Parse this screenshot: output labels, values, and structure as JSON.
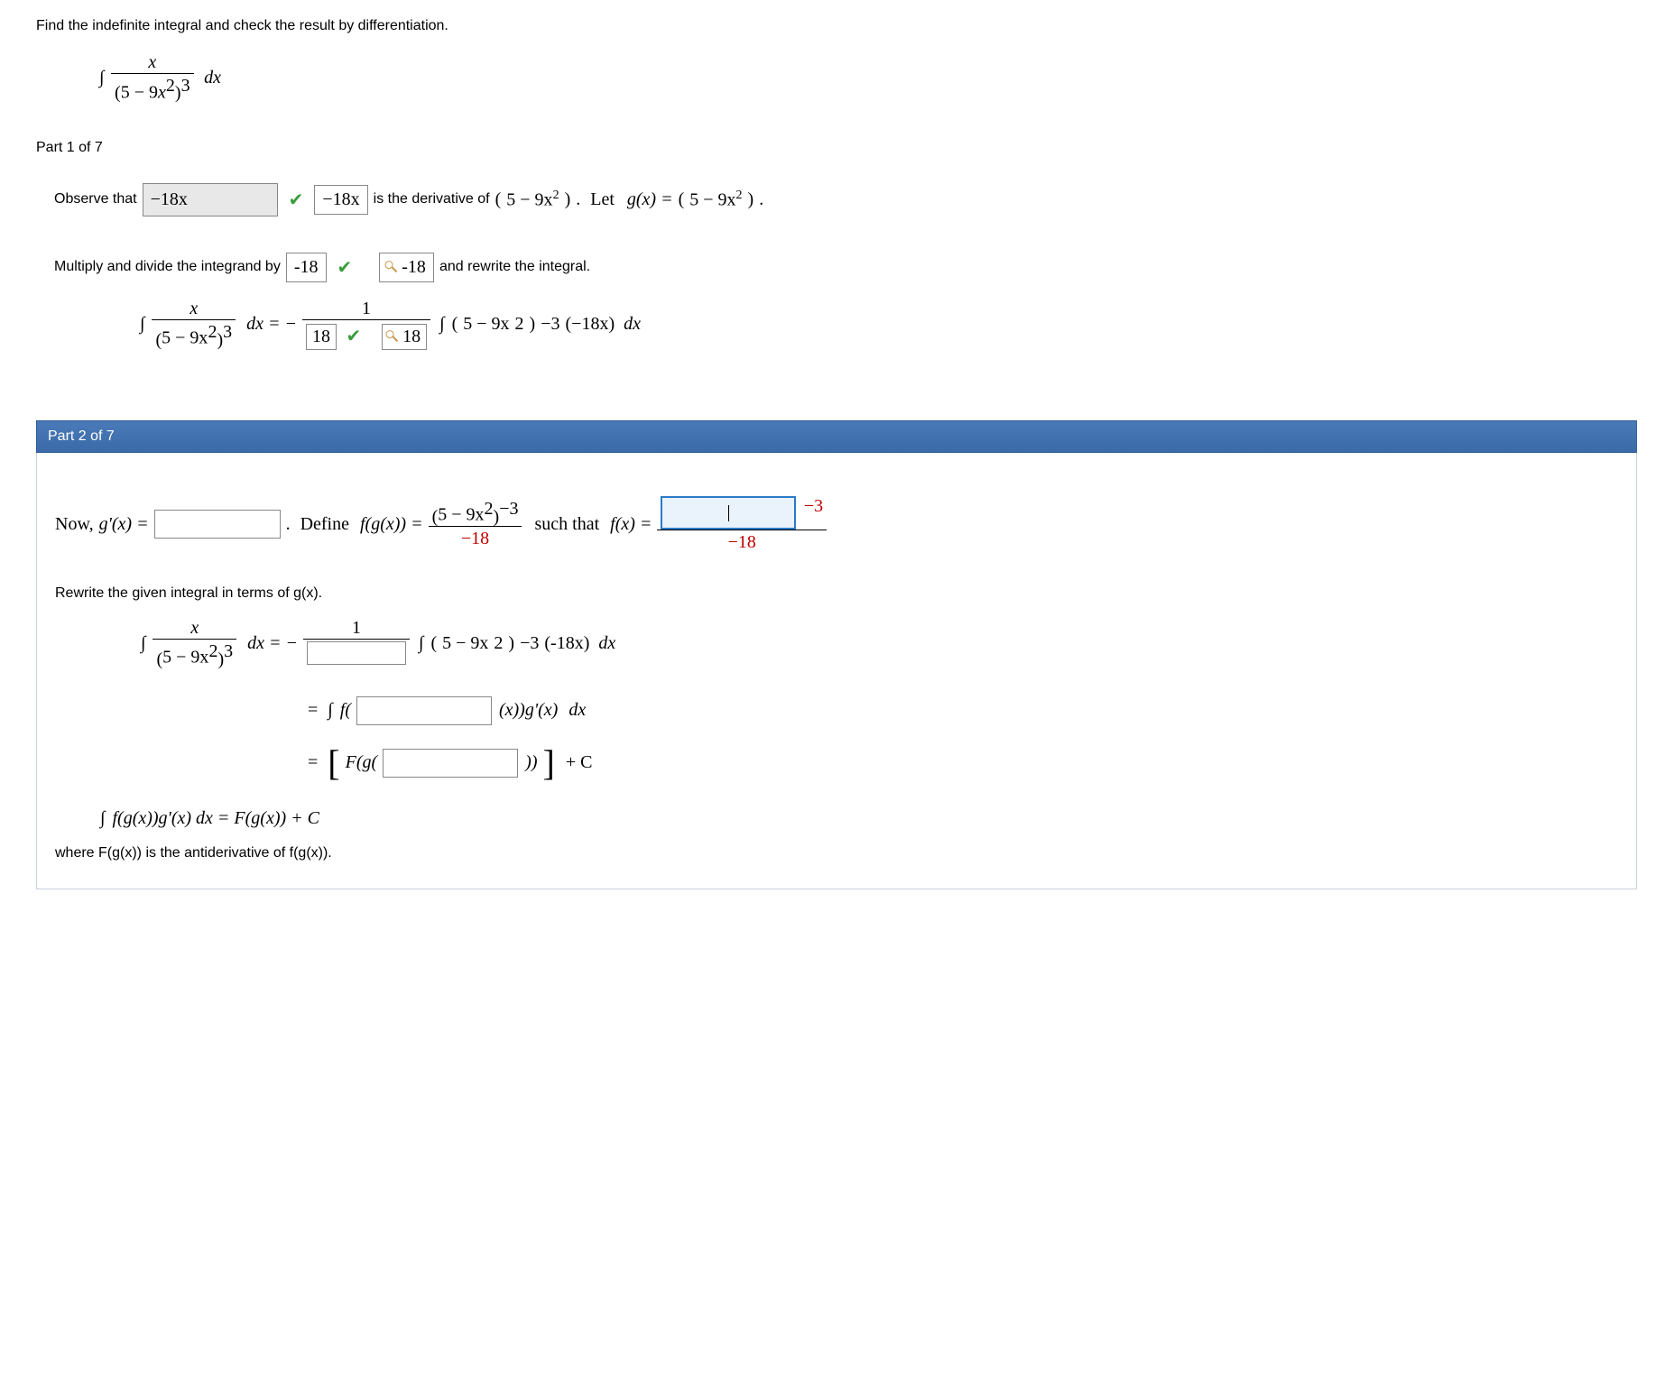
{
  "problem": "Find the indefinite integral and check the result by differentiation.",
  "integral": {
    "numerator_var": "x",
    "denom_base_a": "5",
    "denom_sign": " − ",
    "denom_coef": "9",
    "denom_var": "x",
    "denom_var_exp": "2",
    "denom_exp": "3",
    "dvar": "dx"
  },
  "part1": {
    "label": "Part 1 of 7",
    "observe_text_a": "Observe that",
    "observe_input": "−18x",
    "observe_answer": "−18x",
    "observe_text_b": "is the derivative of",
    "expr_5m9x2": "5 − 9x",
    "exp2": "2",
    "let_text": "Let",
    "g_def": "g(x) =",
    "multiply_text": "Multiply and divide the integrand by",
    "mult_box": "-18",
    "key_box": "-18",
    "rewrite_text": "and rewrite the integral.",
    "eq_dx": "dx = −",
    "eq_frac_num": "1",
    "eq_input1": "18",
    "eq_key1": "18",
    "neg3": "−3",
    "minus18x": "(−18x)",
    "dx": "dx"
  },
  "part2": {
    "label": "Part 2 of 7",
    "now_text": "Now,",
    "gprime": "g'(x) =",
    "define_text": "Define",
    "fgx": "f(g(x)) =",
    "suchthat": "such that",
    "fx": "f(x) =",
    "neg3": "−3",
    "neg18": "−18",
    "rewrite_heading": "Rewrite the given integral in terms of  g(x).",
    "eq_frac_num": "1",
    "minus18x": "(-18x)",
    "dx": "dx",
    "f_open": "f(",
    "xgp": "(x))g'(x)",
    "Fgopen": "F(g(",
    "close2": "))",
    "plusc": "+ C",
    "rule_line": "f(g(x))g'(x) dx = F(g(x)) + C",
    "where_text": "where  F(g(x))  is the antiderivative of  f(g(x))."
  }
}
